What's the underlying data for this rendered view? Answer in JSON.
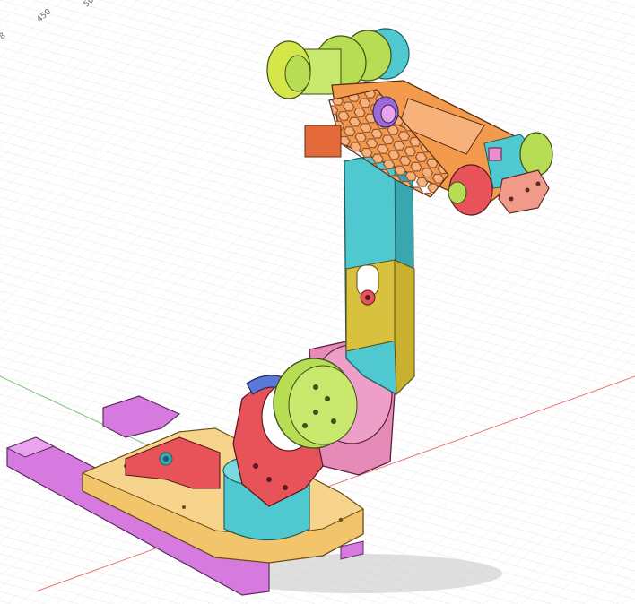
{
  "viewport": {
    "ruler_labels": [
      "450",
      "50"
    ],
    "grid_color": "#dcdcdc",
    "background": "#ffffff"
  },
  "axes": {
    "x_axis_color": "#e57373",
    "y_axis_color": "#7cc47c"
  },
  "model": {
    "colors": {
      "base_plate": "#f2c46b",
      "feet": "#d77ae0",
      "turntable": "#4fc9cf",
      "shoulder_bracket": "#e8535a",
      "shoulder_clamp": "#5a78d6",
      "shoulder_motor": "#b7dd55",
      "shoulder_housing": "#e68ab8",
      "arm_link": "#4fc9cf",
      "arm_joint": "#d8c13f",
      "elbow_motor": "#b7dd55",
      "forearm": "#f39a4c",
      "forearm_cover": "#e8535a",
      "wrist": "#e8535a",
      "end_effector": "#f29a8a",
      "accent_purple": "#9b6ad6",
      "accent_pink": "#e98fd0"
    }
  }
}
